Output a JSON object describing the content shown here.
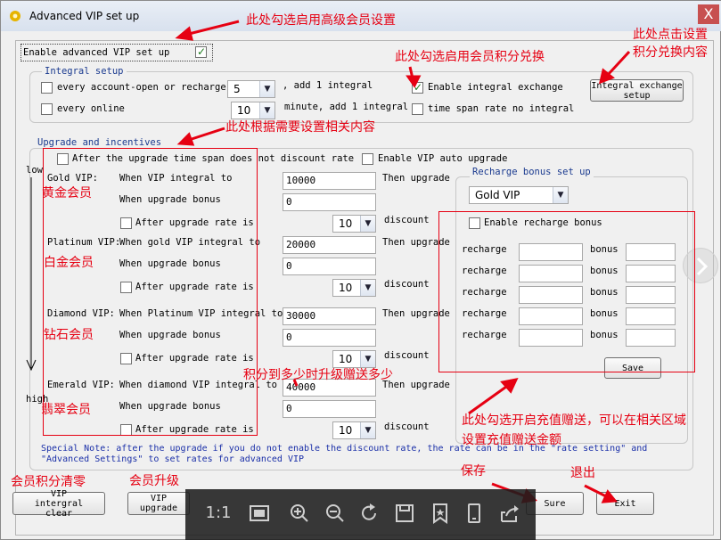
{
  "window": {
    "title": "Advanced VIP set up",
    "close_label": "X"
  },
  "top": {
    "enable_label": "Enable advanced VIP set up",
    "enable_checked": true
  },
  "integral_setup": {
    "legend": "Integral setup",
    "every_label": "every account-open or recharge",
    "every_value": "5",
    "every_suffix": ", add 1 integral",
    "online_label": "every online",
    "online_value": "10",
    "online_suffix": "minute, add 1 integral",
    "exchange_label": "Enable integral exchange",
    "exchange_checked": true,
    "timespan_label": "time span rate no integral",
    "exchange_button": "Integral exchange setup"
  },
  "upgrade": {
    "legend": "Upgrade and incentives",
    "span_label": "After the upgrade time span does not discount rate",
    "auto_label": "Enable VIP auto upgrade",
    "low_label": "low",
    "high_label": "high",
    "then_upgrade": "Then upgrade",
    "bonus_label": "When upgrade bonus",
    "rate_label": "After upgrade rate is",
    "discount_label": "discount",
    "tiers": [
      {
        "name": "Gold VIP:",
        "cond": "When VIP integral to",
        "value": "10000",
        "bonus": "0",
        "rate": "10"
      },
      {
        "name": "Platinum VIP:",
        "cond": "When gold VIP integral to",
        "value": "20000",
        "bonus": "0",
        "rate": "10"
      },
      {
        "name": "Diamond VIP:",
        "cond": "When Platinum VIP integral to",
        "value": "30000",
        "bonus": "0",
        "rate": "10"
      },
      {
        "name": "Emerald VIP:",
        "cond": "When diamond VIP integral to",
        "value": "40000",
        "bonus": "0",
        "rate": "10"
      }
    ]
  },
  "recharge": {
    "legend": "Recharge bonus set up",
    "level": "Gold VIP",
    "enable_label": "Enable recharge bonus",
    "recharge_label": "recharge",
    "bonus_label": "bonus",
    "save_label": "Save"
  },
  "note": {
    "line1": "Special Note: after the upgrade if you do not enable the discount rate, the rate can be in the \"rate setting\" and",
    "line2": "\"Advanced Settings\" to set rates for advanced VIP"
  },
  "buttons": {
    "clear": "VIP intergral clear",
    "upgrade": "VIP upgrade",
    "sure": "Sure",
    "exit": "Exit"
  },
  "annotations": {
    "enable_adv": "此处勾选启用高级会员设置",
    "enable_exchange": "此处勾选启用会员积分兑换",
    "click_setup_1": "此处点击设置",
    "click_setup_2": "积分兑换内容",
    "set_content": "此处根据需要设置相关内容",
    "gold": "黄金会员",
    "platinum": "白金会员",
    "diamond": "钻石会员",
    "emerald": "翡翠会员",
    "points_upgrade": "积分到多少时升级赠送多少",
    "recharge_1": "此处勾选开启充值赠送，可以在相关区域",
    "recharge_2": "设置充值赠送金额",
    "clear_points": "会员积分清零",
    "member_upgrade": "会员升级",
    "save": "保存",
    "exit": "退出"
  },
  "image_toolbar": {
    "ratio_label": "1:1"
  },
  "colors": {
    "annotation": "#e60012",
    "legend": "#1a3a8f",
    "note": "#1a2fa8"
  }
}
